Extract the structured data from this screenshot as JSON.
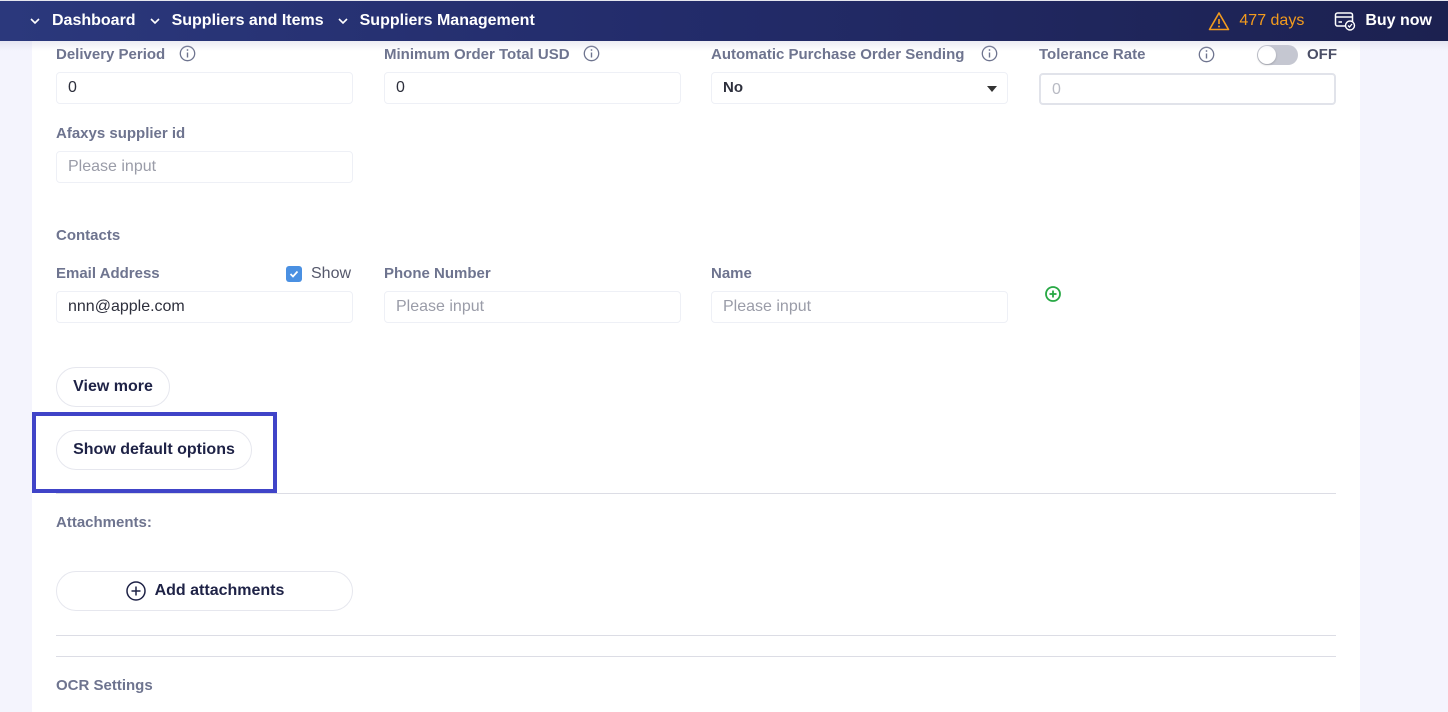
{
  "nav": {
    "breadcrumbs": [
      {
        "label": "Dashboard",
        "icon": "chevron-down-icon"
      },
      {
        "label": "Suppliers and Items",
        "icon": "chevron-down-icon"
      },
      {
        "label": "Suppliers Management",
        "icon": "chevron-down-icon"
      }
    ],
    "trial": {
      "icon": "warning-icon",
      "label": "477 days",
      "color": "#f29b1e"
    },
    "buy": {
      "icon": "billing-card-icon",
      "label": "Buy now"
    }
  },
  "form": {
    "delivery_period": {
      "label": "Delivery Period",
      "value": "0",
      "info_icon": "info-icon"
    },
    "minimum_order_total": {
      "label": "Minimum Order Total USD",
      "value": "0",
      "info_icon": "info-icon"
    },
    "auto_po_sending": {
      "label": "Automatic Purchase Order Sending",
      "selected": "No",
      "info_icon": "info-icon"
    },
    "tolerance_rate": {
      "label": "Tolerance Rate",
      "placeholder": "0",
      "toggle_state": "OFF",
      "toggle_on": false,
      "info_icon": "info-icon"
    },
    "afaxys_supplier_id": {
      "label": "Afaxys supplier id",
      "value": "",
      "placeholder": "Please input"
    }
  },
  "contacts": {
    "title": "Contacts",
    "email": {
      "label": "Email Address",
      "value": "nnn@apple.com",
      "show_label": "Show",
      "show_checked": true
    },
    "phone": {
      "label": "Phone Number",
      "value": "",
      "placeholder": "Please input"
    },
    "name": {
      "label": "Name",
      "value": "",
      "placeholder": "Please input"
    },
    "add_icon": "add-circle-icon",
    "add_color": "#27a844"
  },
  "buttons": {
    "view_more": "View more",
    "show_default_options": "Show default options",
    "add_attachments": "Add attachments"
  },
  "attachments": {
    "title": "Attachments:"
  },
  "ocr": {
    "title": "OCR Settings"
  },
  "highlight_color": "#4044c8"
}
